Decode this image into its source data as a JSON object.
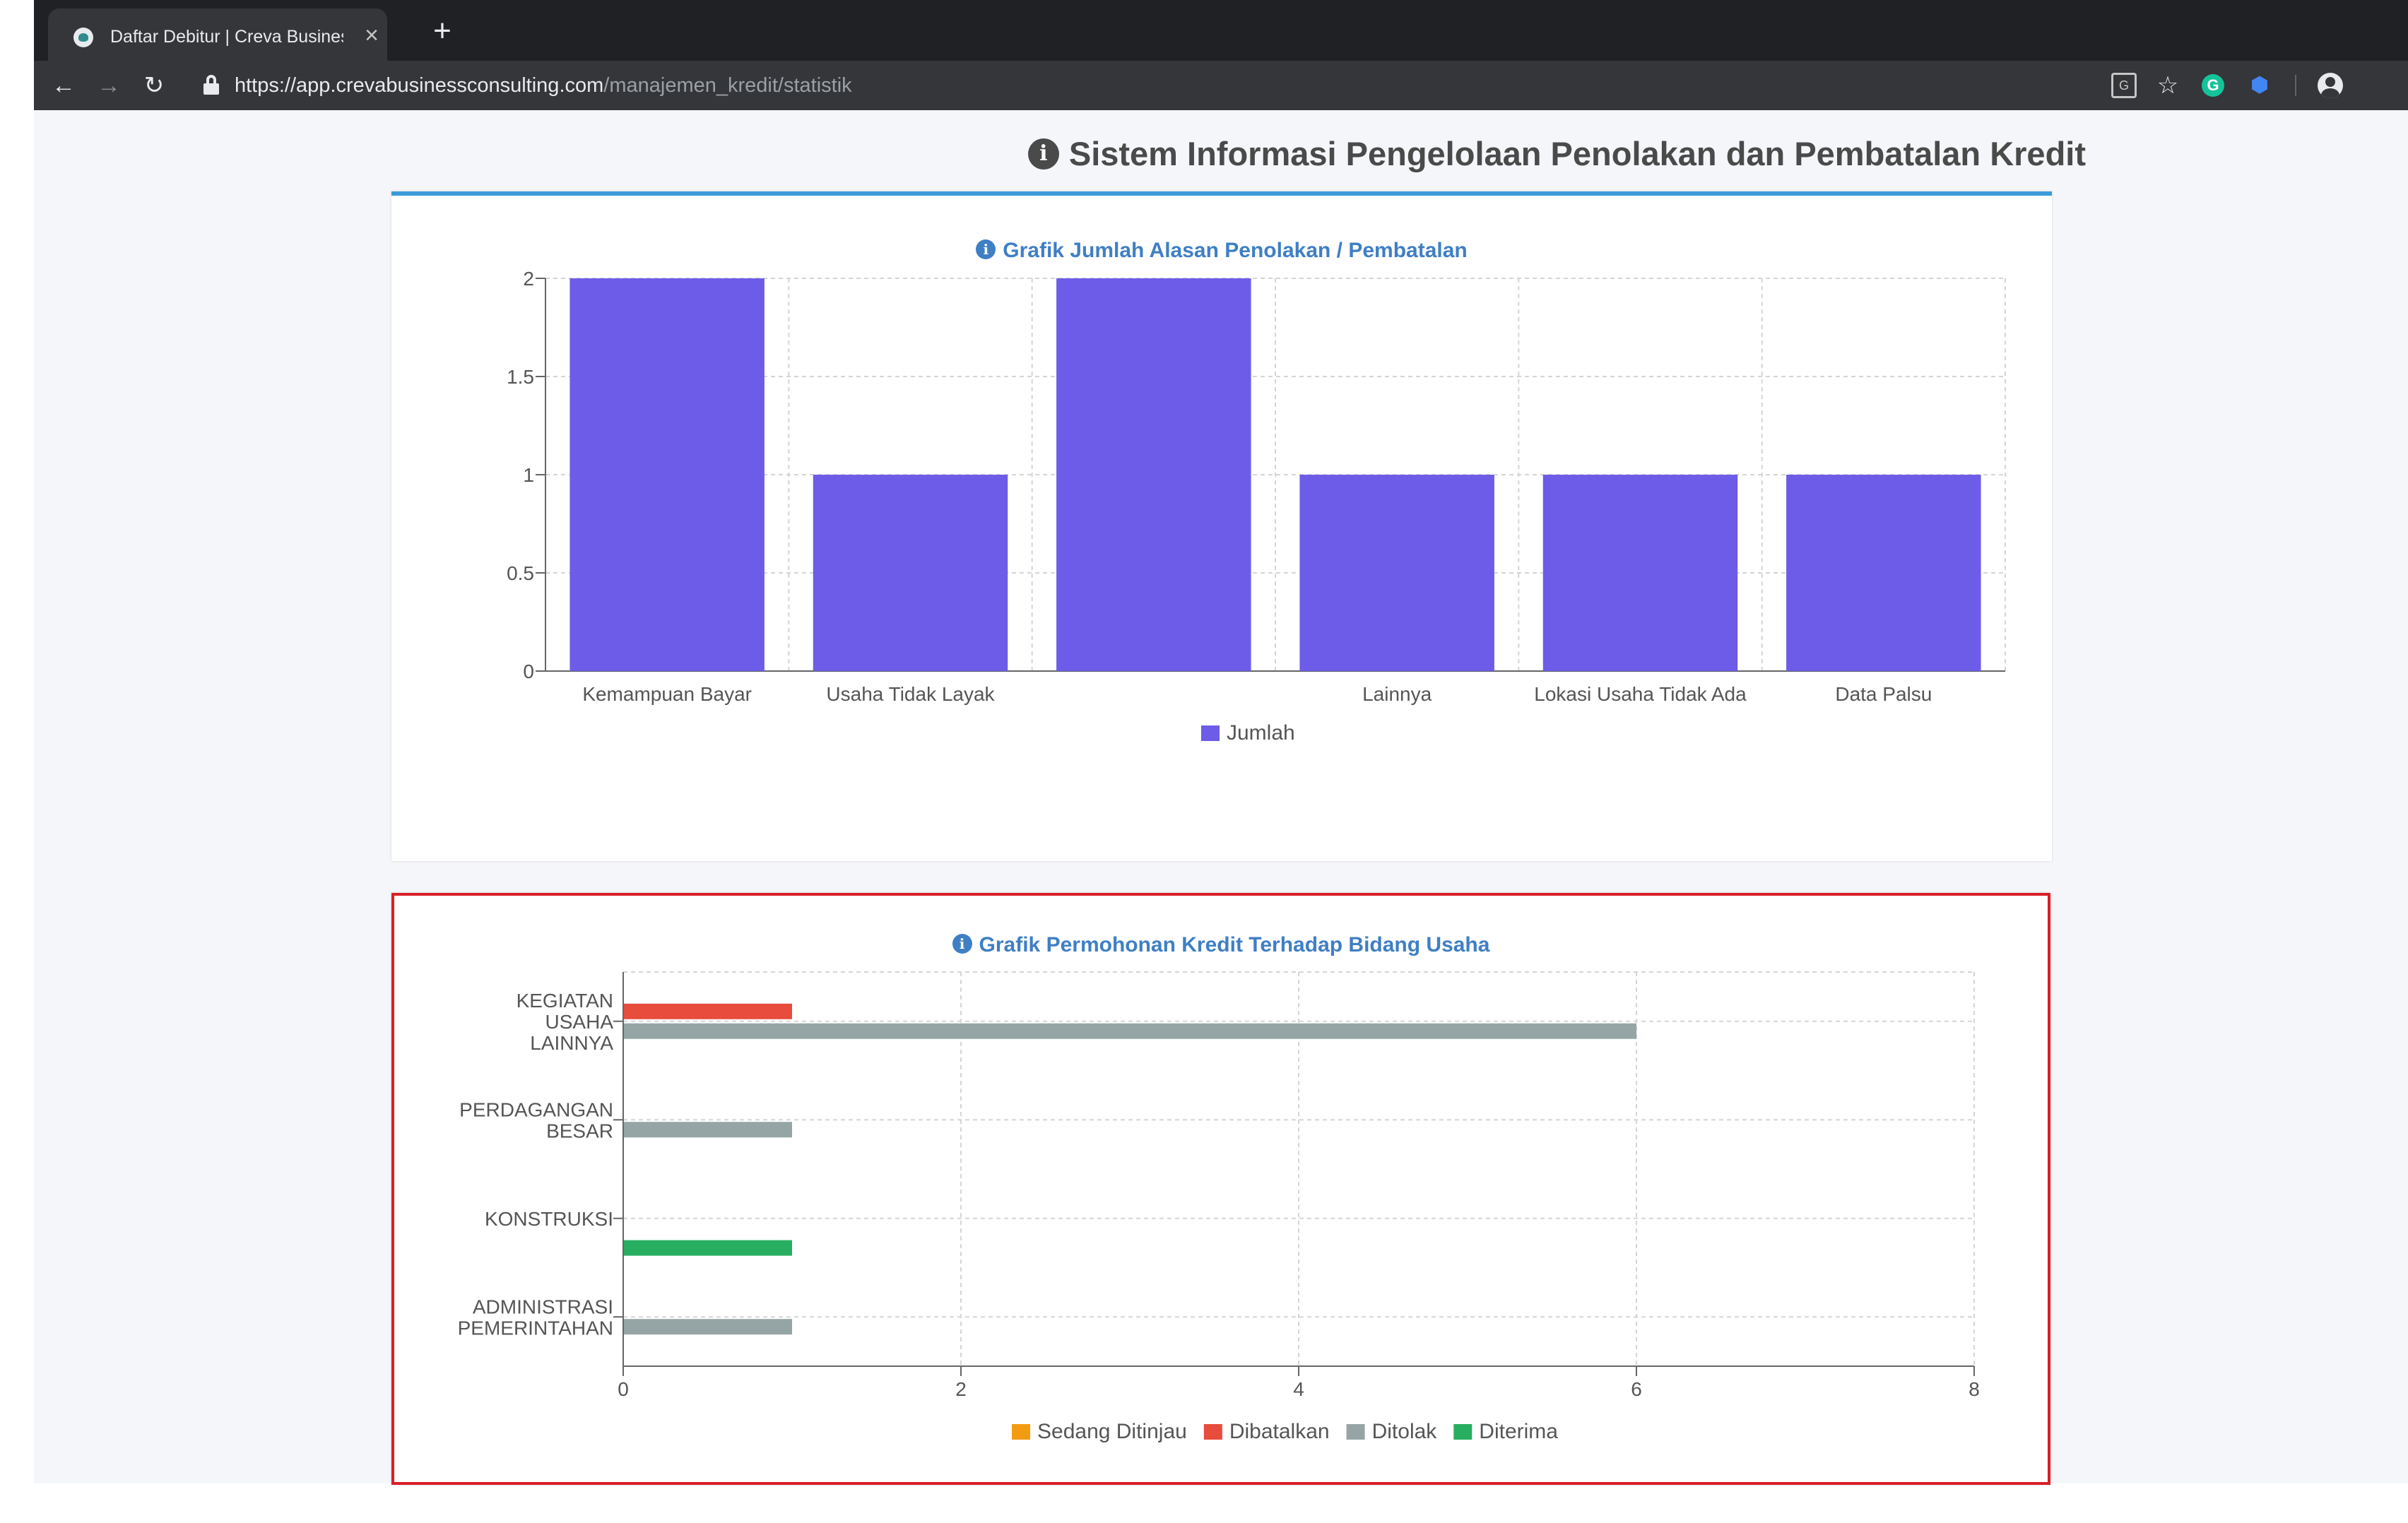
{
  "browser": {
    "tab_title": "Daftar Debitur | Creva Business Consulting",
    "tab_close": "×",
    "new_tab": "+",
    "url_host": "https://app.crevabusinessconsulting.com",
    "url_path": "/manajemen_kredit/statistik",
    "back": "←",
    "forward": "→",
    "reload": "↻",
    "star": "☆",
    "grammarly": "G",
    "extension": "⬢",
    "menu": "⋮",
    "translate": "G"
  },
  "page": {
    "title": "Sistem Informasi Pengelolaan Penolakan dan Pembatalan Kredit",
    "info_glyph": "i"
  },
  "chart_data": [
    {
      "type": "bar",
      "title": "Grafik Jumlah Alasan Penolakan / Pembatalan",
      "categories": [
        "Kemampuan Bayar",
        "Usaha Tidak Layak",
        "",
        "Lainnya",
        "Lokasi Usaha Tidak Ada",
        "Data Palsu"
      ],
      "series": [
        {
          "name": "Jumlah",
          "values": [
            2,
            1,
            2,
            1,
            1,
            1
          ],
          "color": "#6c5ce7"
        }
      ],
      "yticks": [
        "0",
        "0.5",
        "1",
        "1.5",
        "2"
      ],
      "ylim": [
        0,
        2
      ],
      "grid": true,
      "legend": "bottom"
    },
    {
      "type": "bar",
      "orientation": "horizontal",
      "title": "Grafik Permohonan Kredit Terhadap Bidang Usaha",
      "categories": [
        [
          "KEGIATAN",
          "USAHA",
          "LAINNYA"
        ],
        [
          "PERDAGANGAN",
          "BESAR"
        ],
        [
          "KONSTRUKSI"
        ],
        [
          "ADMINISTRASI",
          "PEMERINTAHAN"
        ]
      ],
      "series": [
        {
          "name": "Sedang Ditinjau",
          "values": [
            0,
            0,
            0,
            0
          ],
          "color": "#f39c12"
        },
        {
          "name": "Dibatalkan",
          "values": [
            1,
            0,
            0,
            0
          ],
          "color": "#e74c3c"
        },
        {
          "name": "Ditolak",
          "values": [
            6,
            1,
            0,
            1
          ],
          "color": "#95a5a6"
        },
        {
          "name": "Diterima",
          "values": [
            0,
            0,
            1,
            0
          ],
          "color": "#27ae60"
        }
      ],
      "xticks": [
        "0",
        "2",
        "4",
        "6",
        "8"
      ],
      "xlim": [
        0,
        8
      ],
      "grid": true,
      "legend": "bottom"
    }
  ]
}
